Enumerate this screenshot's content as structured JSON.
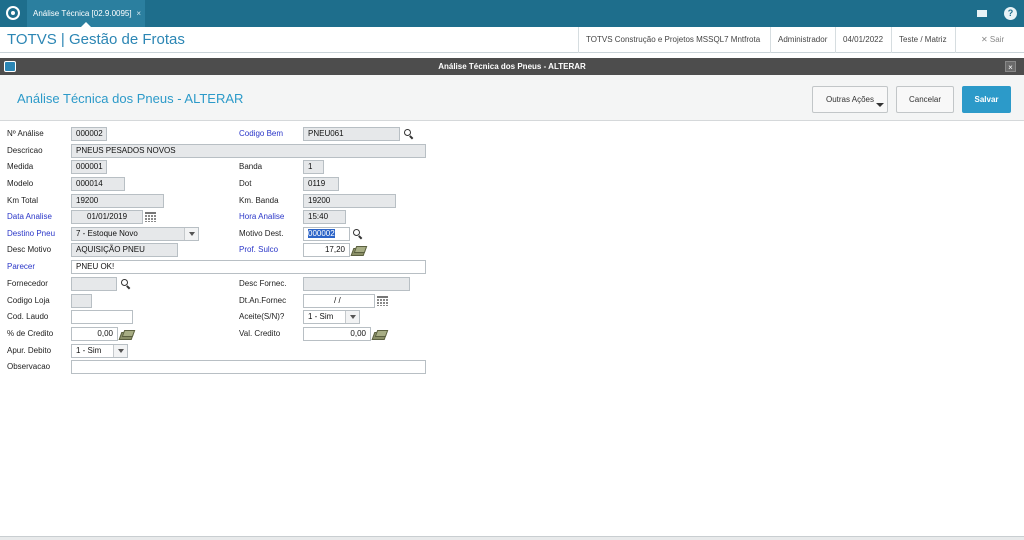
{
  "tab": {
    "label": "Análise Técnica [02.9.0095]",
    "close": "×"
  },
  "app": {
    "title": "TOTVS | Gestão de Frotas",
    "company": "TOTVS Construção e Projetos MSSQL7 Mntfrota",
    "user": "Administrador",
    "date": "04/01/2022",
    "branch": "Teste / Matriz",
    "exit": "✕  Sair"
  },
  "window": {
    "title": "Análise Técnica dos Pneus - ALTERAR",
    "close": "×"
  },
  "page": {
    "title": "Análise Técnica dos Pneus - ALTERAR",
    "buttons": {
      "more": "Outras Ações",
      "cancel": "Cancelar",
      "save": "Salvar"
    }
  },
  "form": {
    "n_analise": {
      "label": "Nº Análise",
      "value": "000002"
    },
    "codigo_bem": {
      "label": "Codigo Bem",
      "value": "PNEU061"
    },
    "descricao": {
      "label": "Descricao",
      "value": "PNEUS PESADOS NOVOS"
    },
    "medida": {
      "label": "Medida",
      "value": "000001"
    },
    "banda": {
      "label": "Banda",
      "value": "1"
    },
    "modelo": {
      "label": "Modelo",
      "value": "000014"
    },
    "dot": {
      "label": "Dot",
      "value": "0119"
    },
    "km_total": {
      "label": "Km Total",
      "value": "19200"
    },
    "km_banda": {
      "label": "Km. Banda",
      "value": "19200"
    },
    "data_analise": {
      "label": "Data Analise",
      "value": "01/01/2019"
    },
    "hora_analise": {
      "label": "Hora Analise",
      "value": "15:40"
    },
    "destino_pneu": {
      "label": "Destino Pneu",
      "value": "7 - Estoque Novo"
    },
    "motivo_dest": {
      "label": "Motivo Dest.",
      "value": "000002"
    },
    "desc_motivo": {
      "label": "Desc Motivo",
      "value": "AQUISIÇÃO PNEU"
    },
    "prof_sulco": {
      "label": "Prof. Sulco",
      "value": "17,20"
    },
    "parecer": {
      "label": "Parecer",
      "value": "PNEU OK!"
    },
    "fornecedor": {
      "label": "Fornecedor",
      "value": ""
    },
    "desc_fornec": {
      "label": "Desc Fornec.",
      "value": ""
    },
    "codigo_loja": {
      "label": "Codigo Loja",
      "value": ""
    },
    "dt_an_fornec": {
      "label": "Dt.An.Fornec",
      "value": "/ /"
    },
    "cod_laudo": {
      "label": "Cod. Laudo",
      "value": ""
    },
    "aceite": {
      "label": "Aceite(S/N)?",
      "value": "1 - Sim"
    },
    "pct_credito": {
      "label": "% de Credito",
      "value": "0,00"
    },
    "val_credito": {
      "label": "Val. Credito",
      "value": "0,00"
    },
    "apur_debito": {
      "label": "Apur. Debito",
      "value": "1 - Sim"
    },
    "observacao": {
      "label": "Observacao",
      "value": ""
    }
  },
  "colors": {
    "topbar": "#1e6e8c",
    "accent": "#2c9ac9",
    "title_bar": "#4d4d4d",
    "required_label": "#2a36c8"
  }
}
